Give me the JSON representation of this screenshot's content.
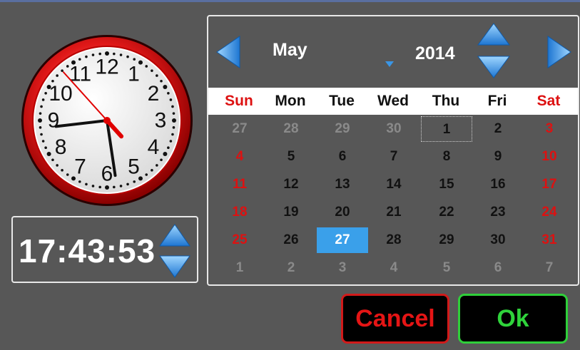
{
  "clock": {
    "numbers": [
      "12",
      "1",
      "2",
      "3",
      "4",
      "5",
      "6",
      "7",
      "8",
      "9",
      "10",
      "11"
    ],
    "time": {
      "hours": 17,
      "minutes": 43,
      "seconds": 53
    }
  },
  "time_display": {
    "text": "17:43:53"
  },
  "calendar": {
    "month": "May",
    "year": "2014",
    "weekdays": [
      "Sun",
      "Mon",
      "Tue",
      "Wed",
      "Thu",
      "Fri",
      "Sat"
    ],
    "weeks": [
      [
        "27",
        "28",
        "29",
        "30",
        "1",
        "2",
        "3"
      ],
      [
        "4",
        "5",
        "6",
        "7",
        "8",
        "9",
        "10"
      ],
      [
        "11",
        "12",
        "13",
        "14",
        "15",
        "16",
        "17"
      ],
      [
        "18",
        "19",
        "20",
        "21",
        "22",
        "23",
        "24"
      ],
      [
        "25",
        "26",
        "27",
        "28",
        "29",
        "30",
        "31"
      ],
      [
        "1",
        "2",
        "3",
        "4",
        "5",
        "6",
        "7"
      ]
    ],
    "today": "1",
    "selected": "27"
  },
  "buttons": {
    "cancel": "Cancel",
    "ok": "Ok"
  },
  "colors": {
    "background": "#575757",
    "weekend": "#dd1111",
    "selected": "#3aa0ea",
    "cancel": "#e51515",
    "ok": "#2fd33b",
    "arrow": "#2f8fe0"
  }
}
